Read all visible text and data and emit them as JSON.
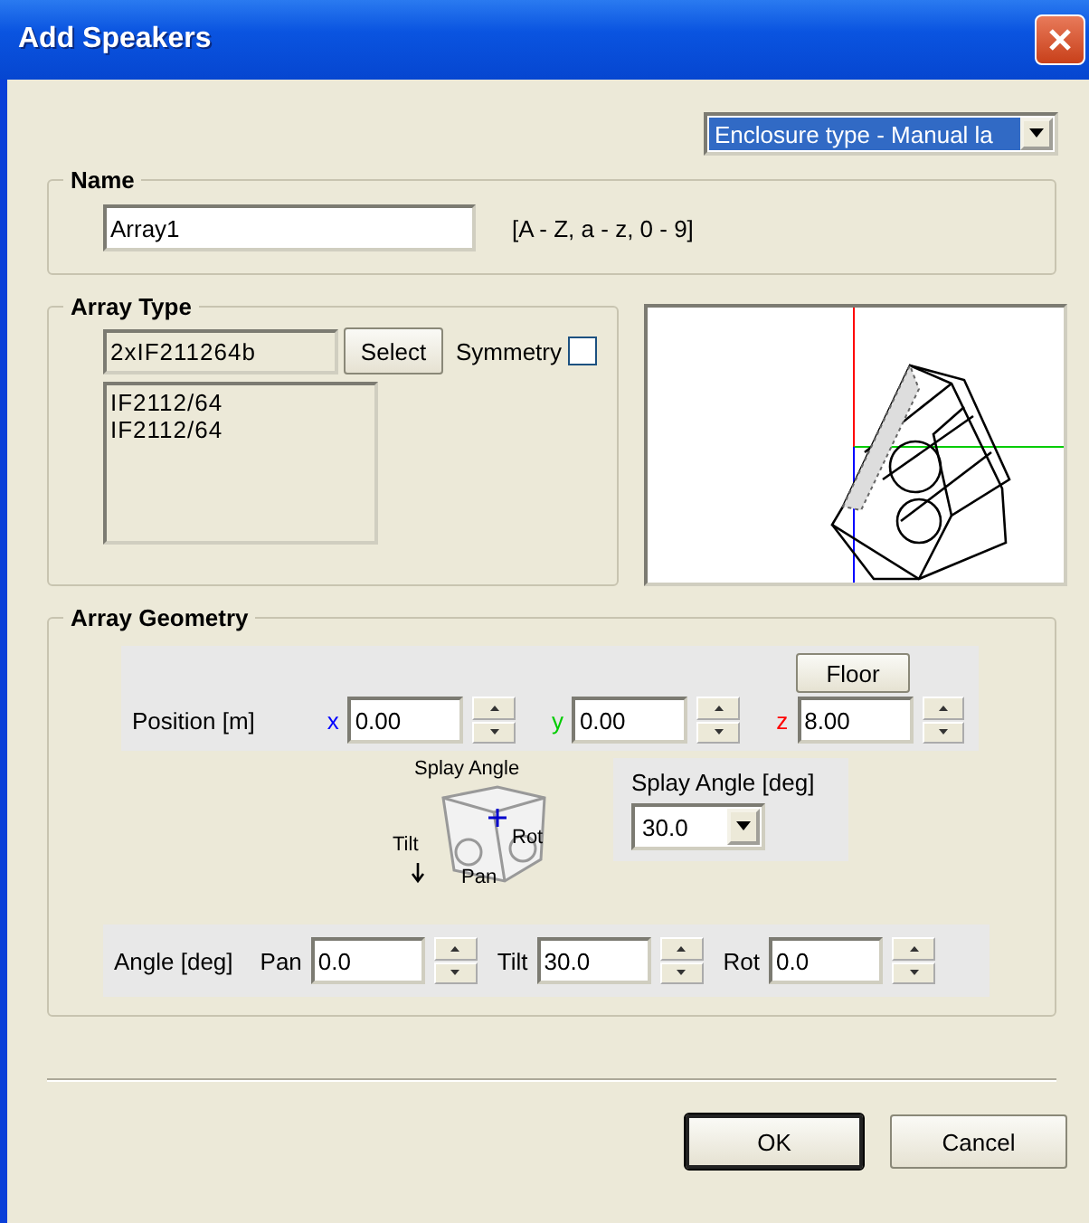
{
  "window": {
    "title": "Add Speakers"
  },
  "enclosure_dropdown": {
    "value": "Enclosure type - Manual la"
  },
  "name_group": {
    "title": "Name",
    "value": "Array1",
    "hint": "[A - Z, a - z, 0 - 9]"
  },
  "array_type": {
    "title": "Array Type",
    "value": "2xIF211264b",
    "select_button": "Select",
    "symmetry": {
      "label": "Symmetry",
      "checked": false
    },
    "list": [
      "IF2112/64",
      "IF2112/64"
    ]
  },
  "array_geometry": {
    "title": "Array Geometry",
    "floor_button": "Floor",
    "position": {
      "label": "Position [m]",
      "axes": [
        {
          "label": "x",
          "value": "0.00",
          "color": "#0000ff"
        },
        {
          "label": "y",
          "value": "0.00",
          "color": "#00cc00"
        },
        {
          "label": "z",
          "value": "8.00",
          "color": "#ff0000"
        }
      ]
    },
    "diagram_labels": [
      "Splay Angle",
      "Tilt",
      "Rot",
      "Pan"
    ],
    "splay": {
      "label": "Splay Angle [deg]",
      "value": "30.0"
    },
    "angle": {
      "label": "Angle [deg]",
      "fields": [
        {
          "label": "Pan",
          "value": "0.0"
        },
        {
          "label": "Tilt",
          "value": "30.0"
        },
        {
          "label": "Rot",
          "value": "0.0"
        }
      ]
    }
  },
  "buttons": [
    {
      "label": "OK",
      "default": true
    },
    {
      "label": "Cancel",
      "default": false
    }
  ]
}
